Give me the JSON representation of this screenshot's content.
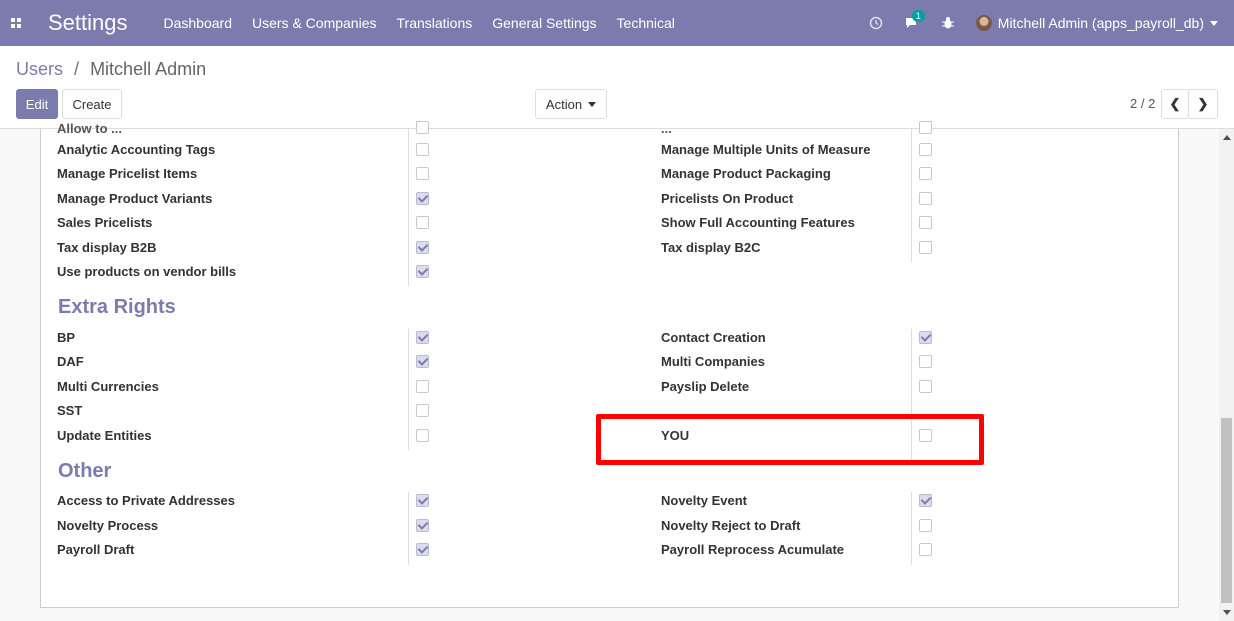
{
  "navbar": {
    "brand": "Settings",
    "menu": [
      "Dashboard",
      "Users & Companies",
      "Translations",
      "General Settings",
      "Technical"
    ],
    "chat_badge": "1",
    "user": "Mitchell Admin (apps_payroll_db)"
  },
  "breadcrumb": {
    "parent": "Users",
    "separator": "/",
    "current": "Mitchell Admin"
  },
  "buttons": {
    "edit": "Edit",
    "create": "Create",
    "action": "Action"
  },
  "pager": {
    "value": "2 / 2"
  },
  "partial_top_row": {
    "left": "Allow to ...",
    "right": "..."
  },
  "technical_rows": [
    {
      "left": "Analytic Accounting Tags",
      "left_checked": false,
      "right": "Manage Multiple Units of Measure",
      "right_checked": false
    },
    {
      "left": "Manage Pricelist Items",
      "left_checked": false,
      "right": "Manage Product Packaging",
      "right_checked": false
    },
    {
      "left": "Manage Product Variants",
      "left_checked": true,
      "right": "Pricelists On Product",
      "right_checked": false
    },
    {
      "left": "Sales Pricelists",
      "left_checked": false,
      "right": "Show Full Accounting Features",
      "right_checked": false
    },
    {
      "left": "Tax display B2B",
      "left_checked": true,
      "right": "Tax display B2C",
      "right_checked": false
    },
    {
      "left": "Use products on vendor bills",
      "left_checked": true
    }
  ],
  "extra_rights": {
    "title": "Extra Rights",
    "rows": [
      {
        "left": "BP",
        "left_checked": true,
        "right": "Contact Creation",
        "right_checked": true
      },
      {
        "left": "DAF",
        "left_checked": true,
        "right": "Multi Companies",
        "right_checked": false
      },
      {
        "left": "Multi Currencies",
        "left_checked": false,
        "right": "Payslip Delete",
        "right_checked": false
      },
      {
        "left": "SST",
        "left_checked": false
      },
      {
        "left": "Update Entities",
        "left_checked": false,
        "right": "YOU",
        "right_checked": false
      }
    ]
  },
  "other": {
    "title": "Other",
    "rows": [
      {
        "left": "Access to Private Addresses",
        "left_checked": true,
        "right": "Novelty Event",
        "right_checked": true
      },
      {
        "left": "Novelty Process",
        "left_checked": true,
        "right": "Novelty Reject to Draft",
        "right_checked": false
      },
      {
        "left": "Payroll Draft",
        "left_checked": true,
        "right": "Payroll Reprocess Acumulate",
        "right_checked": false
      }
    ]
  },
  "colors": {
    "navbar": "#7c7bad",
    "accent": "#7c7bad",
    "highlight": "#ff0000"
  }
}
